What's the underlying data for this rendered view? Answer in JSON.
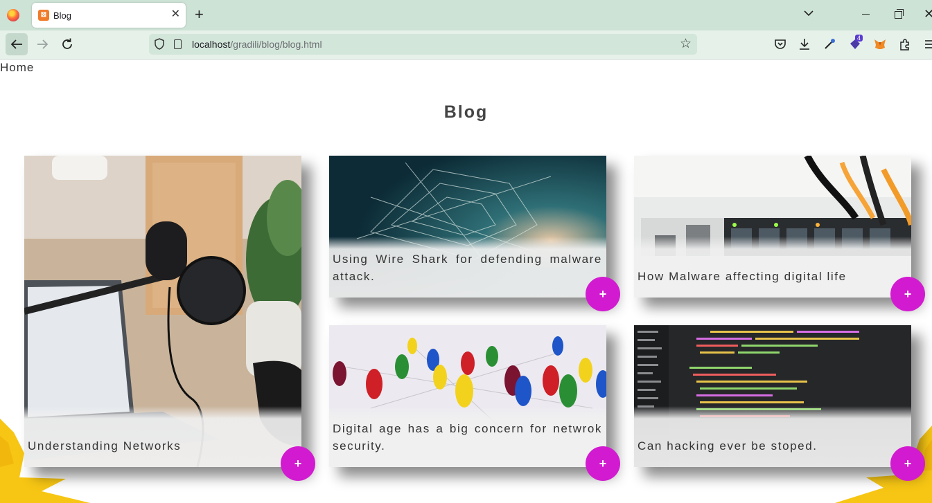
{
  "browser": {
    "tab_title": "Blog",
    "tab_favicon": "xampp-icon",
    "url_host": "localhost",
    "url_path": "/gradili/blog/blog.html",
    "extension_badge": "4"
  },
  "page": {
    "nav_home": "Home",
    "title": "Blog",
    "accent_color": "#d21bd0",
    "cards": [
      {
        "caption": "Understanding Networks",
        "button": "+"
      },
      {
        "caption": "Using Wire Shark for defending malware attack.",
        "button": "+"
      },
      {
        "caption": "How Malware affecting digital life",
        "button": "+"
      },
      {
        "caption": "Digital age has a big concern for netwrok security.",
        "button": "+"
      },
      {
        "caption": "Can hacking ever be stoped.",
        "button": "+"
      }
    ]
  }
}
